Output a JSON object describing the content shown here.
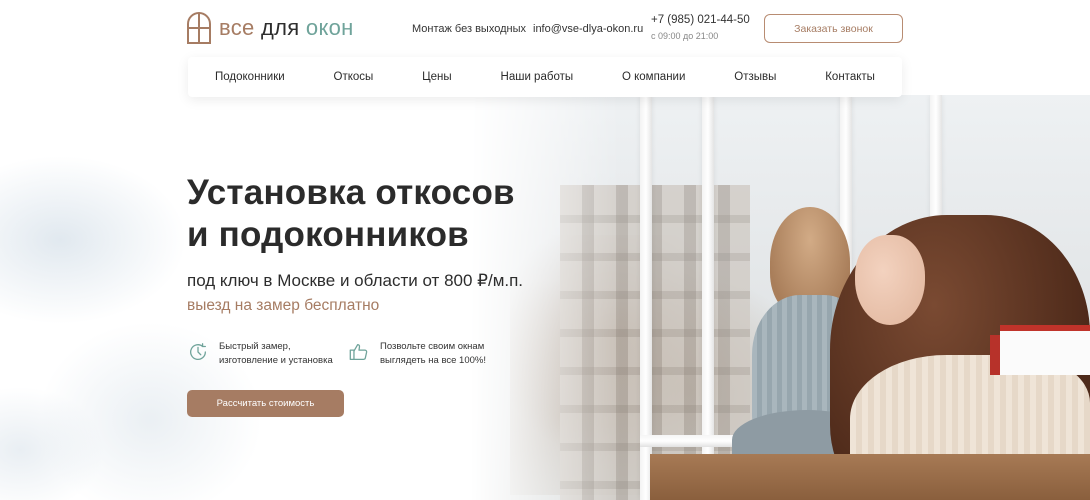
{
  "header": {
    "logo": {
      "word1": "все",
      "word2": "для",
      "word3": "окон"
    },
    "montage": "Монтаж без выходных",
    "email": "info@vse-dlya-okon.ru",
    "phone": "+7 (985) 021-44-50",
    "hours": "с 09:00 до 21:00",
    "call_button": "Заказать звонок"
  },
  "nav": {
    "items": [
      "Подоконники",
      "Откосы",
      "Цены",
      "Наши работы",
      "О компании",
      "Отзывы",
      "Контакты"
    ]
  },
  "hero": {
    "title_line1": "Установка откосов",
    "title_line2": "и подоконников",
    "subtitle": "под ключ в Москве и области от 800 ₽/м.п.",
    "accent": "выезд на замер бесплатно",
    "features": [
      {
        "icon": "clock-icon",
        "line1": "Быстрый замер,",
        "line2": "изготовление и установка"
      },
      {
        "icon": "thumbs-up-icon",
        "line1": "Позвольте своим окнам",
        "line2": "выглядеть на все 100%!"
      }
    ],
    "cta": "Рассчитать стоимость"
  },
  "colors": {
    "accent": "#a67c63",
    "logo_green": "#6fa39a",
    "text": "#2b2b2b"
  }
}
